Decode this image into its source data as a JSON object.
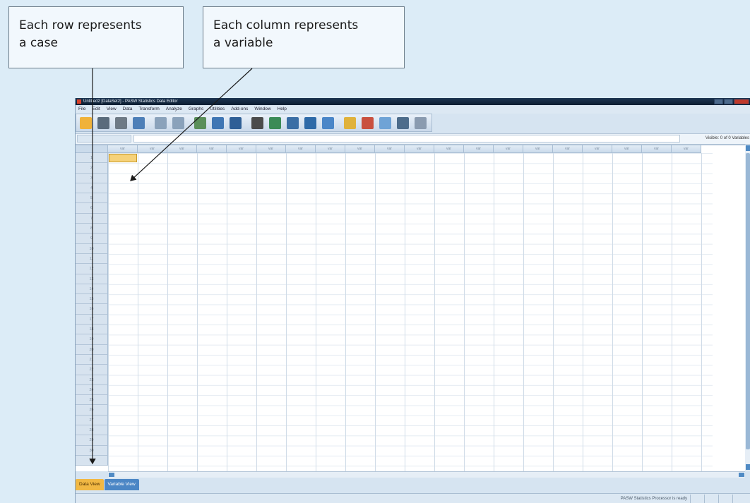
{
  "callouts": {
    "row": [
      "Each row represents",
      "a case"
    ],
    "column": [
      "Each column represents",
      "a variable"
    ]
  },
  "window": {
    "title": "Untitled2 [DataSet2] - PASW Statistics Data Editor"
  },
  "menu": [
    "File",
    "Edit",
    "View",
    "Data",
    "Transform",
    "Analyze",
    "Graphs",
    "Utilities",
    "Add-ons",
    "Window",
    "Help"
  ],
  "toolbar": {
    "buttons": [
      {
        "icon": "open-folder-icon",
        "color": "#f0b23a"
      },
      {
        "icon": "save-icon",
        "color": "#5a6b7c"
      },
      {
        "icon": "print-icon",
        "color": "#6e7a86"
      },
      {
        "icon": "dialog-recall-icon",
        "color": "#4d7fb8"
      },
      {
        "icon": "undo-icon",
        "color": "#8aa2bb"
      },
      {
        "icon": "redo-icon",
        "color": "#8aa2bb"
      },
      {
        "icon": "goto-case-icon",
        "color": "#5a8f5a"
      },
      {
        "icon": "goto-variable-icon",
        "color": "#3f76b4"
      },
      {
        "icon": "variables-icon",
        "color": "#2f5f96"
      },
      {
        "icon": "find-icon",
        "color": "#4b4b4b"
      },
      {
        "icon": "insert-cases-icon",
        "color": "#3b8b57"
      },
      {
        "icon": "insert-variable-icon",
        "color": "#3a6ea5"
      },
      {
        "icon": "split-file-icon",
        "color": "#2e6aa8"
      },
      {
        "icon": "weight-cases-icon",
        "color": "#4a86c8"
      },
      {
        "icon": "select-cases-icon",
        "color": "#e0b23b"
      },
      {
        "icon": "value-labels-icon",
        "color": "#c9503f"
      },
      {
        "icon": "use-variable-sets-icon",
        "color": "#6fa3d6"
      },
      {
        "icon": "show-all-variables-icon",
        "color": "#4d6c8b"
      },
      {
        "icon": "spelling-icon",
        "color": "#8a9bb0"
      }
    ]
  },
  "status": {
    "visible": "Visible: 0 of 0 Variables",
    "processor": "PASW Statistics Processor is ready"
  },
  "grid": {
    "column_header": "var",
    "column_count": 20,
    "rows": [
      "1",
      "2",
      "3",
      "4",
      "5",
      "6",
      "7",
      "8",
      "9",
      "10",
      "11",
      "12",
      "13",
      "14",
      "15",
      "16",
      "17",
      "18",
      "19",
      "20",
      "21",
      "22",
      "23",
      "24",
      "25",
      "26",
      "27",
      "28",
      "29",
      "30",
      "31"
    ]
  },
  "tabs": [
    "Data View",
    "Variable View"
  ],
  "colors": {
    "active_cell": "#f6d27a",
    "data_view_tab": "#f1b843",
    "variable_view_tab": "#4b86c5"
  }
}
